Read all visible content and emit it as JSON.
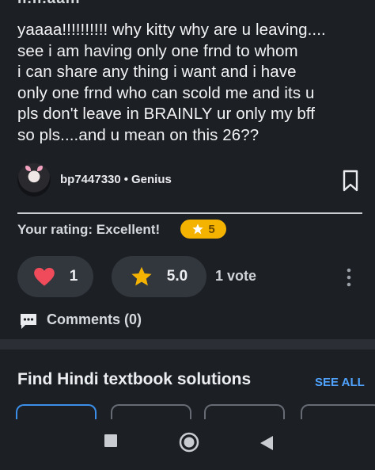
{
  "cut_off_text": "ıı.ıı.aaııı",
  "answer": {
    "lines": [
      "yaaaa!!!!!!!!!! why kitty why are u leaving....",
      "see i am having only one frnd to whom",
      "i can share any thing i want and i have",
      "only one frnd who can scold me and its u",
      "pls don't leave in BRAINLY ur only my bff",
      "so pls....and u mean on this 26??"
    ]
  },
  "author": {
    "username": "bp7447330",
    "separator": "•",
    "rank": "Genius"
  },
  "rating": {
    "label": "Your rating: Excellent!",
    "value": "5"
  },
  "actions": {
    "thanks_count": "1",
    "average_rating": "5.0",
    "votes_label": "1 vote"
  },
  "comments": {
    "label": "Comments (0)"
  },
  "textbook": {
    "title": "Find Hindi textbook solutions",
    "see_all": "SEE ALL"
  },
  "colors": {
    "background": "#1c1f24",
    "pill": "#32363d",
    "heart": "#ef4b5a",
    "star": "#f5b301",
    "link": "#4fa3ff"
  },
  "icons": [
    "bookmark-icon",
    "star-icon",
    "heart-icon",
    "more-vertical-icon",
    "comment-icon",
    "nav-recents-icon",
    "nav-home-icon",
    "nav-back-icon"
  ]
}
